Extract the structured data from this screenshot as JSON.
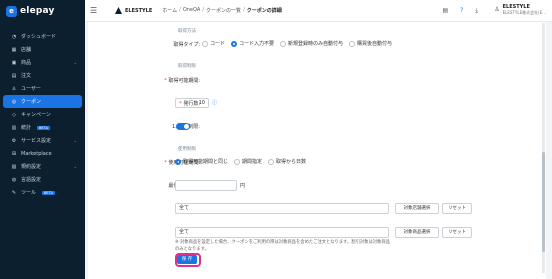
{
  "app": {
    "logo_text": "elepay",
    "logo_letter": "e"
  },
  "sidebar": {
    "items": [
      {
        "label": "ダッシュボード",
        "icon": "dashboard-icon"
      },
      {
        "label": "店舗",
        "icon": "store-icon"
      },
      {
        "label": "商品",
        "icon": "product-icon",
        "expandable": true
      },
      {
        "label": "注文",
        "icon": "order-icon"
      },
      {
        "label": "ユーザー",
        "icon": "user-icon"
      },
      {
        "label": "クーポン",
        "icon": "coupon-icon",
        "active": true
      },
      {
        "label": "キャンペーン",
        "icon": "campaign-icon"
      },
      {
        "label": "統計",
        "icon": "stats-icon",
        "badge": "BETA"
      },
      {
        "label": "サービス設定",
        "icon": "gear-icon",
        "expandable": true
      },
      {
        "label": "Marketplace",
        "icon": "marketplace-icon"
      },
      {
        "label": "規約設定",
        "icon": "terms-icon",
        "expandable": true
      },
      {
        "label": "言語設定",
        "icon": "language-icon"
      },
      {
        "label": "ツール",
        "icon": "tool-icon",
        "badge": "BETA"
      }
    ]
  },
  "topbar": {
    "brand": "ELESTYLE",
    "breadcrumbs": [
      "ホーム",
      "OneQA",
      "クーポンの一覧",
      "クーポンの詳細"
    ],
    "user_name": "ELESTYLE",
    "user_org": "ELESTYLE株式会社(E..."
  },
  "form": {
    "section_acquire_method": "取得方法",
    "acquire_type_label": "取得タイプ:",
    "acquire_type_options": [
      "コード",
      "コード入力不要",
      "新規登録時のみ自動付与",
      "購買後自動付与"
    ],
    "acquire_type_selected": "コード入力不要",
    "section_acquire_limit": "取得制限",
    "acquire_period_label": "取得可能期間:",
    "issue_count_label": "発行数:",
    "issue_count_value": "10",
    "once_per_person_label": "1人1回制限:",
    "section_usage_limit": "使用制限",
    "usage_period_label": "使用可能期間:",
    "usage_period_options": [
      "取得可能期間と同じ",
      "期間指定",
      "取得から日数"
    ],
    "usage_period_selected": "取得可能期間と同じ",
    "min_purchase_label": "最低購入金額:",
    "min_purchase_unit": "円",
    "target_store_label": "対象店舗:",
    "target_store_value": "全て",
    "target_store_select": "対象店舗選択",
    "reset": "リセット",
    "target_product_label": "対象商品:",
    "target_product_value": "全て",
    "target_product_select": "対象商品選択",
    "product_note": "※ 対象商品を設定した場合、クーポンをご利用の際は対象商品を含めたご注文となります。割引対象は対象商品のみとなります。",
    "save": "保 存"
  },
  "colors": {
    "accent": "#1b74e4",
    "sidebar_bg": "#0b1f2e",
    "highlight_ring": "#e0308a"
  }
}
